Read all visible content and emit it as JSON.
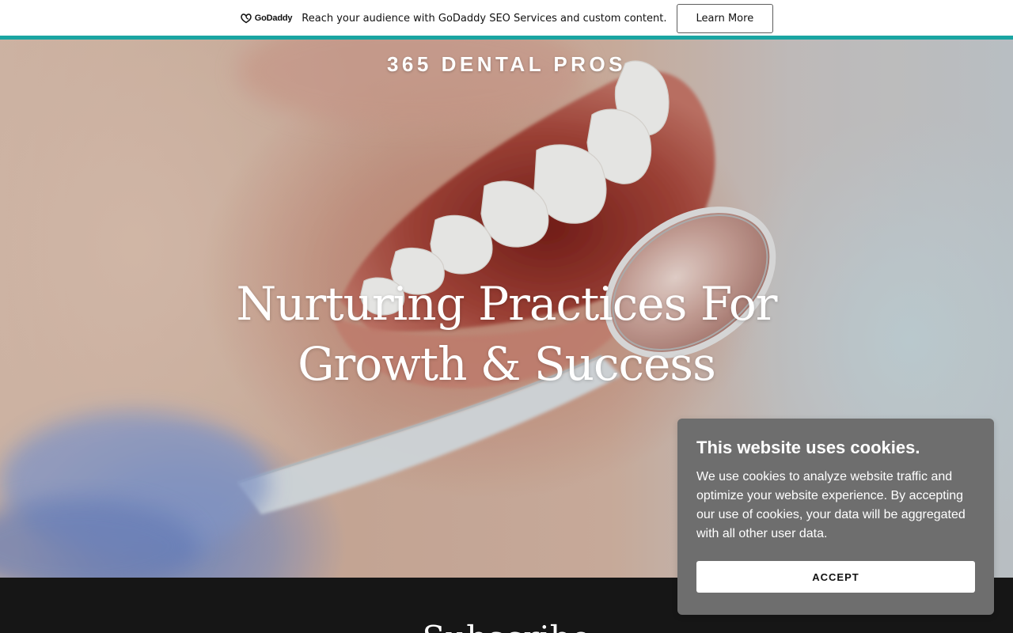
{
  "promo_bar": {
    "logo_text": "GoDaddy",
    "logo_icon": "godaddy-logo-icon",
    "message": "Reach your audience with GoDaddy SEO Services and custom content.",
    "button_label": "Learn More",
    "accent_color": "#1aa5a2"
  },
  "hero": {
    "brand": "365 DENTAL PROS",
    "headline_line1": "Nurturing Practices For",
    "headline_line2": "Growth & Success",
    "image_description_icon": "dental-mirror-smile-image"
  },
  "subscribe_section": {
    "heading": "Subscribe",
    "background_color": "#161616"
  },
  "cookie_banner": {
    "title": "This website uses cookies.",
    "body": "We use cookies to analyze website traffic and optimize your website experience. By accepting our use of cookies, your data will be aggregated with all other user data.",
    "accept_label": "ACCEPT",
    "background_color": "#6e6e6e"
  }
}
